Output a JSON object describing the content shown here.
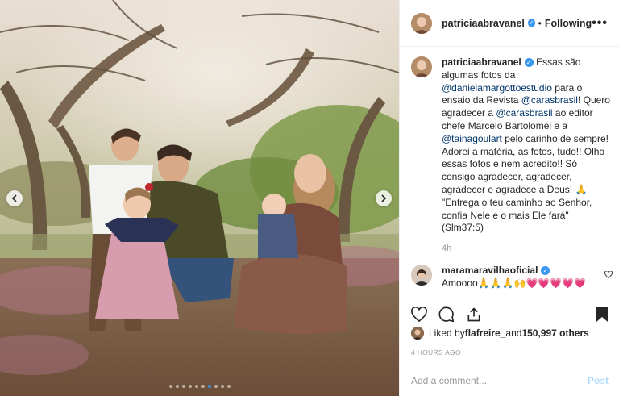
{
  "account": {
    "username": "patriciaabravanel",
    "follow_status": "Following",
    "more_label": "•••",
    "separator": "•"
  },
  "caption": {
    "username": "patriciaabravanel",
    "part1": "Essas são algumas fotos da ",
    "mention1": "@danielamargottoestudio",
    "part2": " para o ensaio da Revista ",
    "mention2": "@carasbrasil",
    "part3": "! Quero agradecer a ",
    "mention3": "@carasbrasil",
    "part4": " ao editor chefe Marcelo Bartolomei e a ",
    "mention4": "@tainagoulart",
    "part5": " pelo carinho de sempre! Adorei a matéria, as fotos, tudo!! Olho essas fotos e nem acredito!! Só consigo agradecer, agradecer, agradecer e agradece a Deus! 🙏 \"Entrega o teu caminho ao Senhor, confia Nele e o mais Ele fará\" (Slm37:5)",
    "time": "4h"
  },
  "comment": {
    "username": "maramaravilhaoficial",
    "text": "Amoooo🙏🙏🙏🙌💗💗💗💗💗"
  },
  "likes": {
    "prefix": "Liked by ",
    "user": "flafreire_",
    "middle": " and ",
    "count": "150,997 others"
  },
  "posted": "4 HOURS AGO",
  "add_comment": {
    "placeholder": "Add a comment...",
    "post_label": "Post"
  },
  "carousel": {
    "dot_count": 10,
    "active_index": 6
  },
  "icons": {
    "prev": "chevron-left-icon",
    "next": "chevron-right-icon",
    "like": "heart-icon",
    "comment": "comment-icon",
    "share": "share-icon",
    "save": "bookmark-icon",
    "verified": "verified-badge-icon"
  },
  "colors": {
    "accent": "#3897f0",
    "mention": "#003569",
    "muted": "#999999",
    "post_disabled": "#b3dbff"
  }
}
